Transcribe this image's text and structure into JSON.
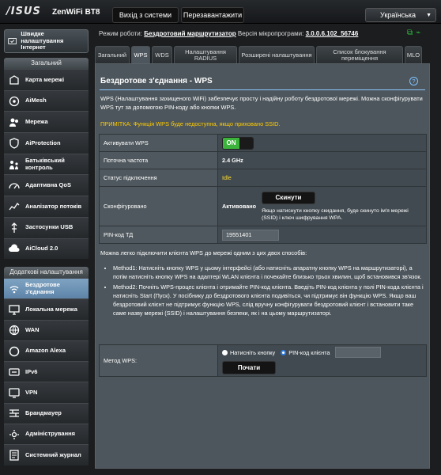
{
  "header": {
    "brand": "/ISUS",
    "model": "ZenWiFi BT8",
    "logout_label": "Вихід з системи",
    "reboot_label": "Перезавантажити",
    "language": "Українська"
  },
  "status": {
    "mode_label": "Режим роботи:",
    "mode_value": "Бездротовий маршрутизатор",
    "firmware_label": "Версія мікропрограми:",
    "firmware_value": "3.0.0.6.102_56746"
  },
  "sidebar": {
    "quick_setup": "Швидке налаштування Інтернет",
    "general_head": "Загальний",
    "general_items": [
      {
        "label": "Карта мережі",
        "icon": "network-map-icon"
      },
      {
        "label": "AiMesh",
        "icon": "aimesh-icon"
      },
      {
        "label": "Мережа",
        "icon": "guest-network-icon"
      },
      {
        "label": "AiProtection",
        "icon": "aiprotection-icon"
      },
      {
        "label": "Батьківський контроль",
        "icon": "parental-control-icon"
      },
      {
        "label": "Адаптивна QoS",
        "icon": "qos-icon"
      },
      {
        "label": "Аналізатор потоків",
        "icon": "traffic-analyzer-icon"
      },
      {
        "label": "Застосунки USB",
        "icon": "usb-icon"
      },
      {
        "label": "AiCloud 2.0",
        "icon": "aicloud-icon"
      }
    ],
    "advanced_head": "Додаткові налаштування",
    "advanced_items": [
      {
        "label": "Бездротове з'єднання",
        "icon": "wireless-icon"
      },
      {
        "label": "Локальна мережа",
        "icon": "lan-icon"
      },
      {
        "label": "WAN",
        "icon": "wan-icon"
      },
      {
        "label": "Amazon Alexa",
        "icon": "alexa-icon"
      },
      {
        "label": "IPv6",
        "icon": "ipv6-icon"
      },
      {
        "label": "VPN",
        "icon": "vpn-icon"
      },
      {
        "label": "Брандмауер",
        "icon": "firewall-icon"
      },
      {
        "label": "Адміністрування",
        "icon": "administration-icon"
      },
      {
        "label": "Системний журнал",
        "icon": "system-log-icon"
      }
    ]
  },
  "tabs": [
    "Загальний",
    "WPS",
    "WDS",
    "Налаштування RADIUS",
    "Розширені налаштування",
    "Список блокування переміщення",
    "MLO"
  ],
  "page": {
    "title": "Бездротове з'єднання - WPS",
    "description": "WPS (Налаштування захищеного WiFi) забезпечує просту і надійну роботу бездротової мережі. Можна сконфігурувати WPS тут за допомогою PIN-коду або кнопки WPS.",
    "note": "ПРИМІТКА: Функція WPS буде недоступна, якщо приховано SSID.",
    "rows": {
      "enable_label": "Активувати WPS",
      "toggle_on": "ON",
      "freq_label": "Поточна частота",
      "freq_value": "2.4 GHz",
      "conn_label": "Статус підключення",
      "conn_value": "Idle",
      "configured_label": "Сконфігуровано",
      "configured_value": "Активовано",
      "reset_button": "Скинути",
      "reset_hint": "Якщо натиснути кнопку скидання, буде скинуто ім'я мережі (SSID) і ключ шифрування WPA.",
      "pin_label": "PIN-код ТД",
      "pin_value": "19551401"
    },
    "howto": "Можна легко підключити клієнта WPS до мережі одним з цих двох способів:",
    "method1": "Method1: Натисніть кнопку WPS у цьому інтерфейсі (або натисніть апаратну кнопку WPS на маршрутизаторі), а потім натисніть кнопку WPS на адаптері WLAN клієнта і почекайте близько трьох хвилин, щоб встановився зв'язок.",
    "method2": "Method2: Почніть WPS-процес клієнта і отримайте PIN-код клієнта. Введіть PIN-код клієнта у полі PIN-кода клієнта і натисніть Start (Пуск). У посібнику до бездротового клієнта подивіться, чи підтримує він функцію WPS. Якщо ваш бездротовий клієнт не підтримує функцію WPS, слід вручну конфігурувати бездротовий клієнт і встановити таке саме назву мережі (SSID) і налаштування безпеки, як і на цьому маршрутизаторі.",
    "wps_method_label": "Метод WPS:",
    "radio_push": "Натисніть кнопку",
    "radio_pin": "PIN-код клієнта",
    "start_button": "Почати"
  }
}
